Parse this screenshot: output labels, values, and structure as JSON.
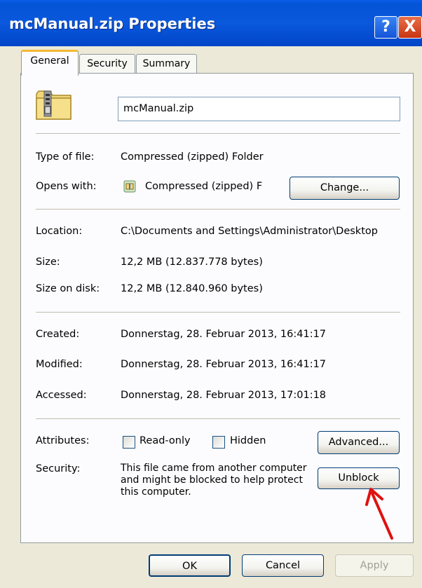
{
  "window": {
    "title": "mcManual.zip Properties",
    "help_button": "?",
    "close_button": "X"
  },
  "tabs": [
    {
      "label": "General",
      "active": true
    },
    {
      "label": "Security",
      "active": false
    },
    {
      "label": "Summary",
      "active": false
    }
  ],
  "general": {
    "file_name": "mcManual.zip",
    "type_label": "Type of file:",
    "type_value": "Compressed (zipped) Folder",
    "opens_label": "Opens with:",
    "opens_value": "Compressed (zipped) F",
    "change_button": "Change...",
    "location_label": "Location:",
    "location_value": "C:\\Documents and Settings\\Administrator\\Desktop",
    "size_label": "Size:",
    "size_value": "12,2 MB (12.837.778 bytes)",
    "size_on_disk_label": "Size on disk:",
    "size_on_disk_value": "12,2 MB (12.840.960 bytes)",
    "created_label": "Created:",
    "created_value": "Donnerstag, 28. Februar 2013, 16:41:17",
    "modified_label": "Modified:",
    "modified_value": "Donnerstag, 28. Februar 2013, 16:41:17",
    "accessed_label": "Accessed:",
    "accessed_value": "Donnerstag, 28. Februar 2013, 17:01:18",
    "attributes_label": "Attributes:",
    "readonly_label": "Read-only",
    "readonly_checked": false,
    "hidden_label": "Hidden",
    "hidden_checked": false,
    "advanced_button": "Advanced...",
    "security_label": "Security:",
    "security_text": "This file came from another computer and might be blocked to help protect this computer.",
    "unblock_button": "Unblock"
  },
  "footer": {
    "ok_button": "OK",
    "cancel_button": "Cancel",
    "apply_button": "Apply"
  },
  "colors": {
    "titlebar": "#0454d8",
    "dialog_bg": "#ece9d8",
    "active_tab_accent": "#f5b834",
    "annotation_arrow": "#e01010"
  },
  "icons": [
    "zip-folder-icon",
    "help-icon",
    "close-icon",
    "compressed-folder-app-icon",
    "red-arrow-annotation"
  ]
}
